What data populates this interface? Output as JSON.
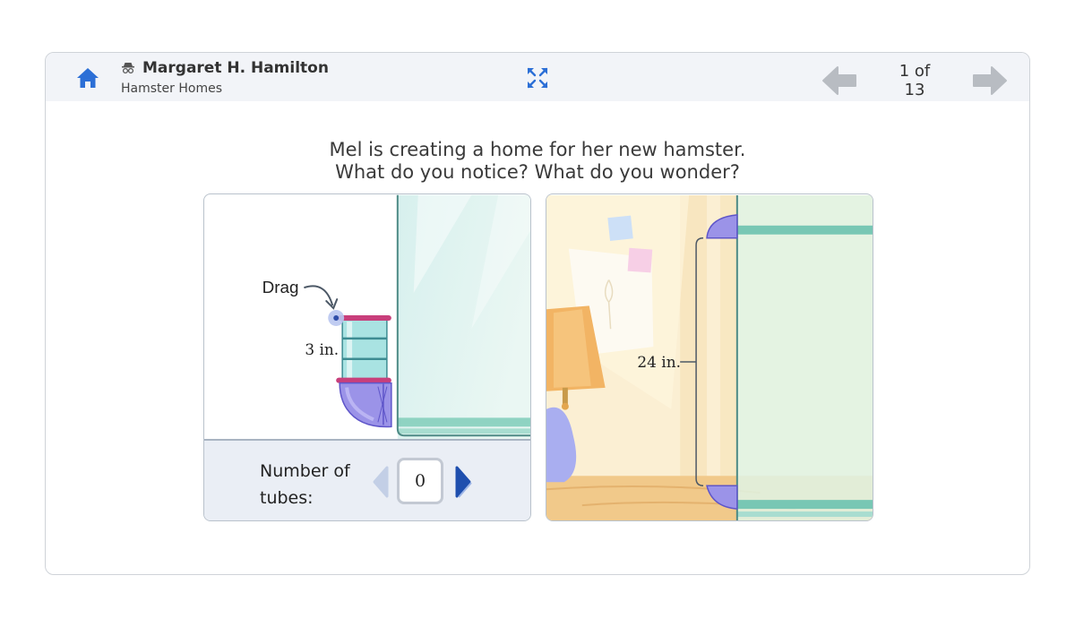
{
  "header": {
    "user_name": "Margaret H. Hamilton",
    "activity_name": "Hamster Homes",
    "page_indicator": "1 of 13",
    "icons": {
      "home": "home-icon",
      "user": "spy-icon",
      "expand": "expand-icon",
      "prev": "arrow-left-icon",
      "next": "arrow-right-icon"
    },
    "colors": {
      "accent": "#2c6fd6",
      "arrow_disabled": "#b8bcc2"
    }
  },
  "prompt": {
    "line1": "Mel is creating a home for her new hamster.",
    "line2": "What do you notice? What do you wonder?"
  },
  "left_panel": {
    "drag_label": "Drag",
    "tube_label": "3 in.",
    "controls": {
      "label_line1": "Number of",
      "label_line2": "tubes:",
      "value": "0"
    }
  },
  "right_panel": {
    "height_label": "24 in."
  }
}
